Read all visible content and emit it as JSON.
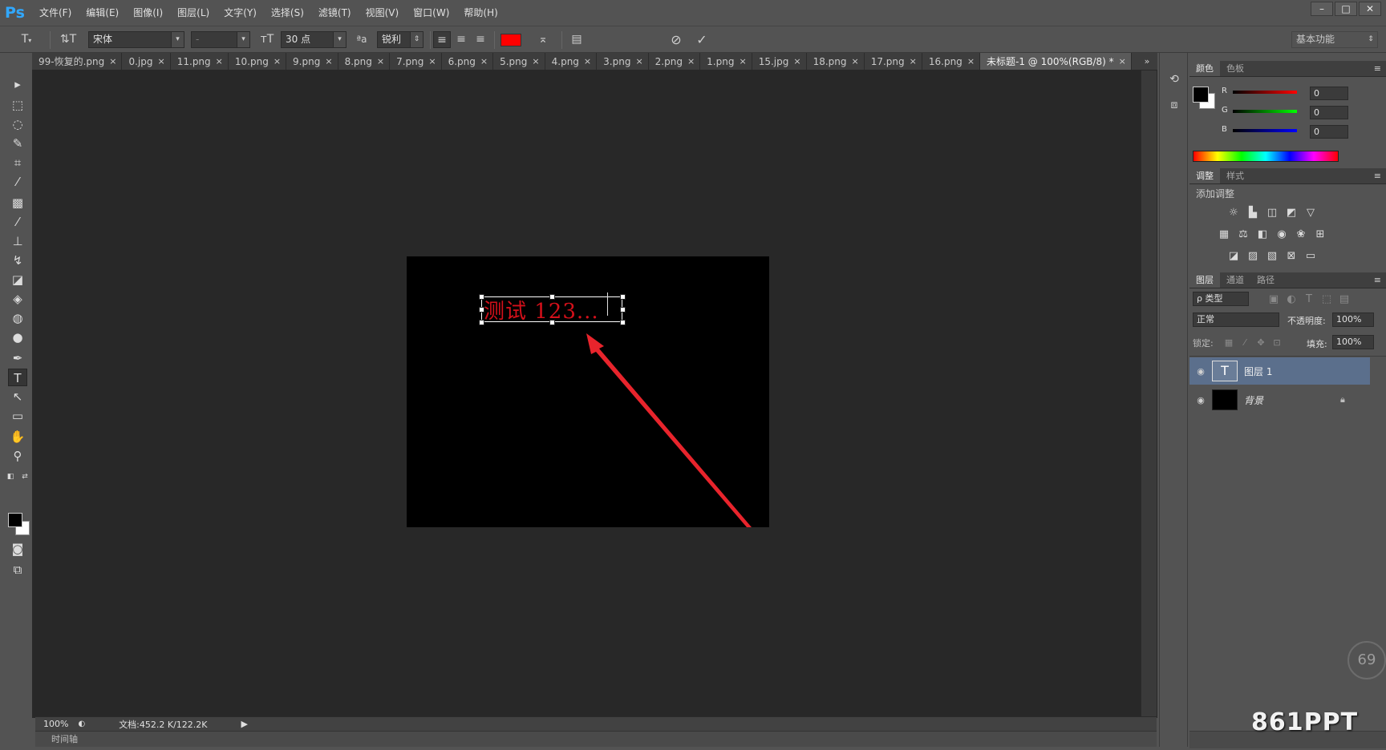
{
  "app": {
    "logo": "Ps"
  },
  "menu": [
    "文件(F)",
    "编辑(E)",
    "图像(I)",
    "图层(L)",
    "文字(Y)",
    "选择(S)",
    "滤镜(T)",
    "视图(V)",
    "窗口(W)",
    "帮助(H)"
  ],
  "window_controls": [
    "–",
    "□",
    "✕"
  ],
  "options_bar": {
    "font_family": "宋体",
    "font_style": "-",
    "font_size": "30 点",
    "antialias": "锐利",
    "text_color": "#ff0000",
    "workspace": "基本功能"
  },
  "tabs": [
    {
      "label": "99-恢复的.png",
      "active": false
    },
    {
      "label": "0.jpg",
      "active": false
    },
    {
      "label": "11.png",
      "active": false
    },
    {
      "label": "10.png",
      "active": false
    },
    {
      "label": "9.png",
      "active": false
    },
    {
      "label": "8.png",
      "active": false
    },
    {
      "label": "7.png",
      "active": false
    },
    {
      "label": "6.png",
      "active": false
    },
    {
      "label": "5.png",
      "active": false
    },
    {
      "label": "4.png",
      "active": false
    },
    {
      "label": "3.png",
      "active": false
    },
    {
      "label": "2.png",
      "active": false
    },
    {
      "label": "1.png",
      "active": false
    },
    {
      "label": "15.jpg",
      "active": false
    },
    {
      "label": "18.png",
      "active": false
    },
    {
      "label": "17.png",
      "active": false
    },
    {
      "label": "16.png",
      "active": false
    },
    {
      "label": "未标题-1 @ 100%(RGB/8) *",
      "active": true
    }
  ],
  "tab_close": "×",
  "tab_overflow": "»",
  "canvas": {
    "text": "测试 123..."
  },
  "status": {
    "zoom": "100%",
    "doc_info": "文档:452.2 K/122.2K"
  },
  "timeline_label": "时间轴",
  "color_panel": {
    "tabs": [
      "颜色",
      "色板"
    ],
    "r_label": "R",
    "g_label": "G",
    "b_label": "B",
    "r": "0",
    "g": "0",
    "b": "0"
  },
  "adjust_panel": {
    "tabs": [
      "调整",
      "样式"
    ],
    "title": "添加调整"
  },
  "layers_panel": {
    "tabs": [
      "图层",
      "通道",
      "路径"
    ],
    "filter": "ρ 类型",
    "blend_mode": "正常",
    "opacity_label": "不透明度:",
    "opacity": "100%",
    "lock_label": "锁定:",
    "fill_label": "填充:",
    "fill": "100%",
    "layers": [
      {
        "name": "图层 1",
        "type": "text",
        "selected": true
      },
      {
        "name": "背景",
        "type": "background",
        "selected": false
      }
    ]
  },
  "watermark": "861PPT",
  "zoom_badge": "69"
}
